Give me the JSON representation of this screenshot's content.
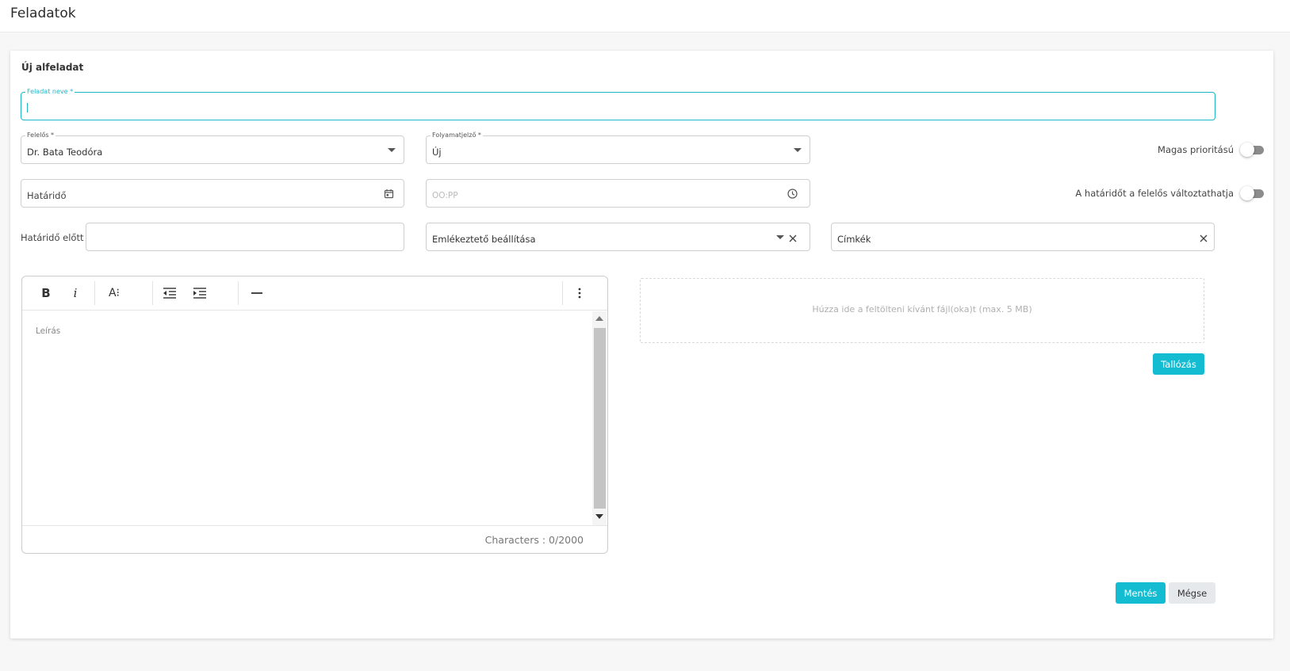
{
  "page": {
    "title": "Feladatok"
  },
  "form": {
    "title": "Új alfeladat",
    "task_name": {
      "label": "Feladat neve *",
      "value": ""
    },
    "responsible": {
      "label": "Felelős *",
      "value": "Dr. Bata Teodóra"
    },
    "status": {
      "label": "Folyamatjelző *",
      "value": "Új"
    },
    "high_priority": {
      "label": "Magas prioritású",
      "enabled": false
    },
    "deadline": {
      "placeholder": "Határidő"
    },
    "time": {
      "placeholder": "OO:PP"
    },
    "deadline_changeable": {
      "label": "A határidőt a felelős változtathatja",
      "enabled": false
    },
    "before_deadline": {
      "label": "Határidő előtt",
      "value": ""
    },
    "reminder": {
      "placeholder": "Emlékeztető beállítása"
    },
    "tags": {
      "placeholder": "Címkék"
    }
  },
  "editor": {
    "toolbar": {
      "bold": "B",
      "italic": "i",
      "font_size": "A⁝",
      "outdent_icon": "outdent-icon",
      "indent_icon": "indent-icon",
      "hr_icon": "horizontal-rule-icon",
      "more_icon": "more-vertical-icon"
    },
    "placeholder": "Leírás",
    "char_count": "Characters : 0/2000"
  },
  "upload": {
    "dropzone_text": "Húzza ide a feltölteni kívánt fájl(oka)t (max. 5 MB)",
    "browse_label": "Tallózás"
  },
  "actions": {
    "save_label": "Mentés",
    "cancel_label": "Mégse"
  },
  "colors": {
    "accent": "#14bcd2",
    "toggle_off": "#8c8c8c",
    "focus_border": "#1fb7c8"
  }
}
